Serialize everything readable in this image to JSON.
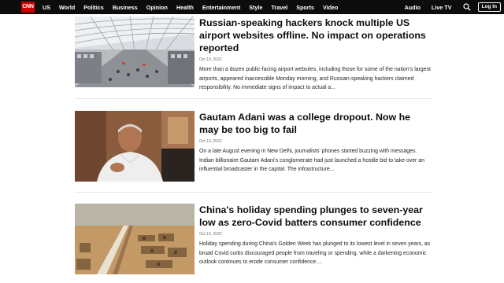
{
  "header": {
    "logo_text": "CNN",
    "nav_left": [
      "US",
      "World",
      "Politics",
      "Business",
      "Opinion",
      "Health",
      "Entertainment",
      "Style",
      "Travel",
      "Sports",
      "Video"
    ],
    "nav_right": [
      "Audio",
      "Live TV"
    ],
    "login_label": "Log In",
    "brand_color": "#cc0000"
  },
  "articles": [
    {
      "headline": "Russian-speaking hackers knock multiple US airport websites offline. No impact on operations reported",
      "date": "Oct 10, 2022",
      "summary": "More than a dozen public-facing airport websites, including those for some of the nation's largest airports, appeared inaccessible Monday morning, and Russian-speaking hackers claimed responsibility. No immediate signs of impact to actual a..."
    },
    {
      "headline": "Gautam Adani was a college dropout. Now he may be too big to fail",
      "date": "Oct 10, 2022",
      "summary": "On a late August evening in New Delhi, journalists' phones started buzzing with messages. Indian billionaire Gautam Adani's conglomerate had just launched a hostile bid to take over an influential broadcaster in the capital. The infrastructure..."
    },
    {
      "headline": "China's holiday spending plunges to seven-year low as zero-Covid batters consumer confidence",
      "date": "Oct 10, 2022",
      "summary": "Holiday spending during China's Golden Week has plunged to its lowest level in seven years, as broad Covid curbs discouraged people from traveling or spending, while a darkening economic outlook continues to erode consumer confidence...."
    }
  ]
}
